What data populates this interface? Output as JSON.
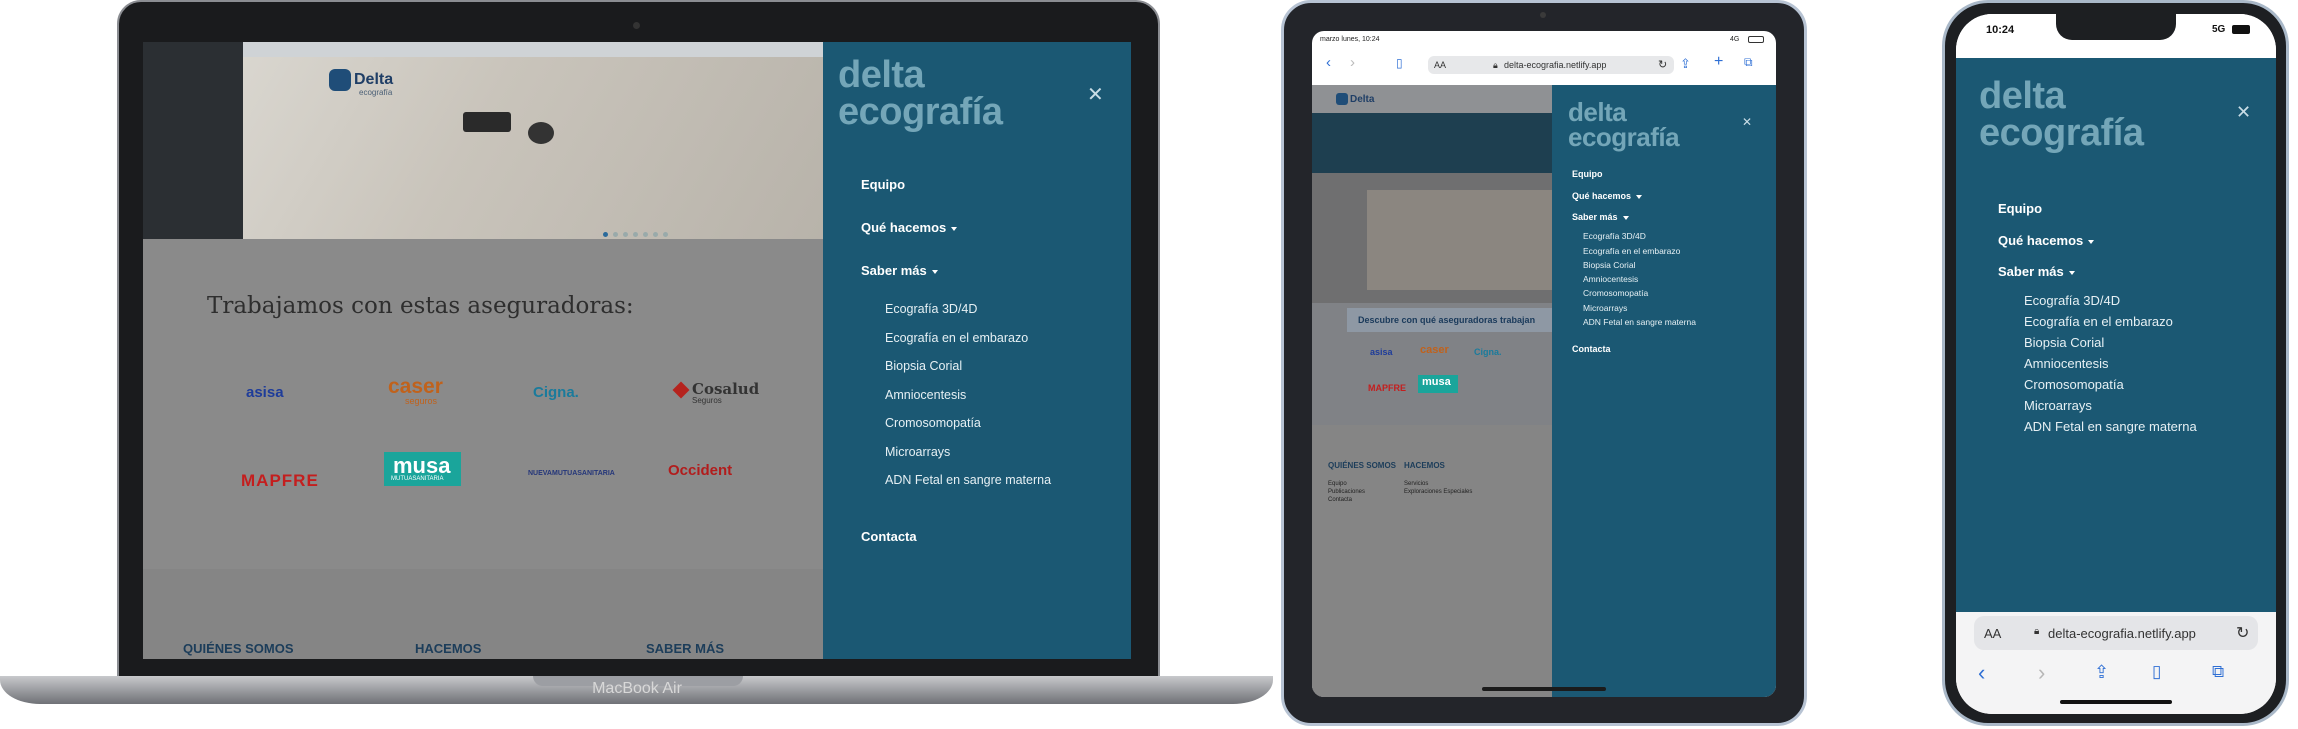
{
  "laptop": {
    "model_label": "MacBook Air",
    "site": {
      "logo_text": "Delta",
      "logo_sub": "ecografía",
      "insurers_title": "Trabajamos con estas aseguradoras:",
      "insurers_row1": [
        "asisa",
        "caser",
        "Cigna.",
        "Cosalud"
      ],
      "insurers_row1_sub": [
        "",
        "seguros",
        "",
        "Seguros"
      ],
      "insurers_row2": [
        "MAPFRE",
        "musa",
        "NUEVAMUTUASANITARIA",
        "Occident"
      ],
      "insurers_row2_sub": [
        "",
        "MUTUASANITARIA",
        "",
        ""
      ],
      "footer_headings": [
        "QUIÉNES SOMOS",
        "HACEMOS",
        "SABER MÁS"
      ]
    }
  },
  "menu": {
    "brand_line1": "delta",
    "brand_line2": "ecografía",
    "close_icon": "close-icon",
    "items": [
      {
        "label": "Equipo",
        "dropdown": false
      },
      {
        "label": "Qué hacemos",
        "dropdown": true
      },
      {
        "label": "Saber más",
        "dropdown": true
      }
    ],
    "sub_items": [
      "Ecografía 3D/4D",
      "Ecografía en el embarazo",
      "Biopsia Corial",
      "Amniocentesis",
      "Cromosomopatía",
      "Microarrays",
      "ADN Fetal en sangre materna"
    ],
    "contact_label": "Contacta"
  },
  "tablet": {
    "status_time": "marzo lunes, 10:24",
    "status_signal": "4G",
    "url_aa": "AA",
    "url": "delta-ecografia.netlify.app",
    "site_banner": "Descubre con qué aseguradoras trabajan",
    "insurers": [
      "asisa",
      "caser",
      "Cigna.",
      "MAPFRE",
      "musa"
    ],
    "footer_headings": [
      "QUIÉNES SOMOS",
      "HACEMOS"
    ],
    "footer_col1": [
      "Equipo",
      "Publicaciones",
      "Contacta"
    ],
    "footer_col2": [
      "Servicios",
      "Exploraciones Especiales"
    ]
  },
  "phone": {
    "status_time": "10:24",
    "status_signal": "5G",
    "url_aa": "AA",
    "url": "delta-ecografia.netlify.app"
  },
  "colors": {
    "menu_bg": "#1b5873",
    "brand_text": "#74a6b8",
    "link_text": "#ffffff"
  }
}
